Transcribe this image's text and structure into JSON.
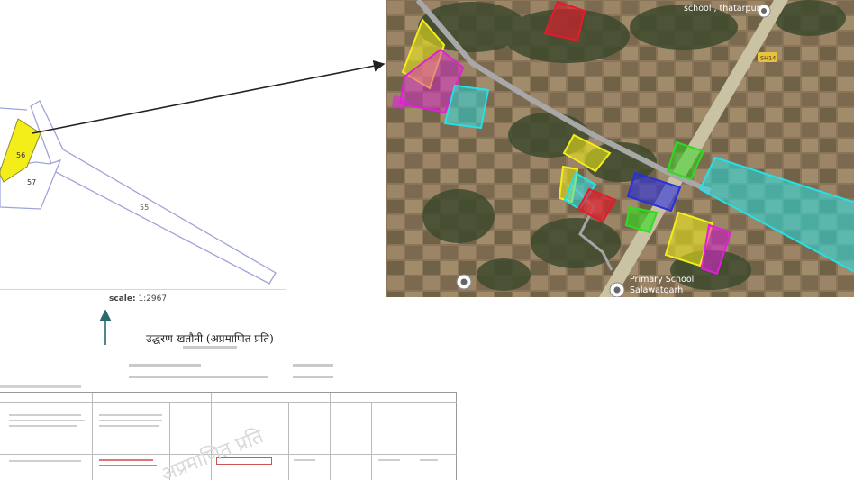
{
  "cadastral": {
    "plot_56": "56",
    "plot_57": "57",
    "plot_55": "55",
    "scale_label": "scale:",
    "scale_value": "1:2967"
  },
  "satellite": {
    "label_school_thatarpur": "school , thatarpur",
    "label_primary_school": "Primary School",
    "label_salawatgarh": "Salawatgarh",
    "road_shield": "SH14"
  },
  "document": {
    "title": "उद्धरण खतौनी (अप्रमाणित प्रति)",
    "watermark": "अप्रमाणित प्रति"
  },
  "colors": {
    "highlight_yellow": "#f3ee1a",
    "satellite_cyan": "#26e0e6",
    "satellite_magenta": "#e020d8",
    "satellite_red": "#e8192b",
    "satellite_green": "#2edc1f",
    "satellite_blue": "#2a2fe0"
  }
}
